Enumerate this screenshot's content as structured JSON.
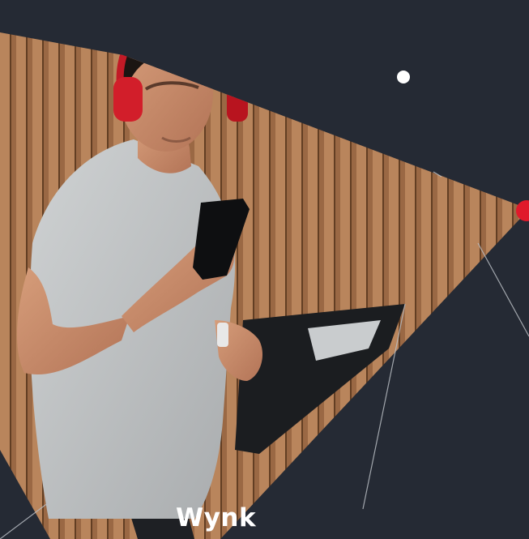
{
  "brand": {
    "title": "Wynk"
  },
  "colors": {
    "background": "#252a34",
    "accent_red": "#e0192b",
    "dot_white": "#ffffff",
    "text": "#ffffff",
    "wood": "#b8825a",
    "headphones": "#d21e2a",
    "tshirt": "#bfc2c3",
    "skin": "#c98e6b"
  }
}
